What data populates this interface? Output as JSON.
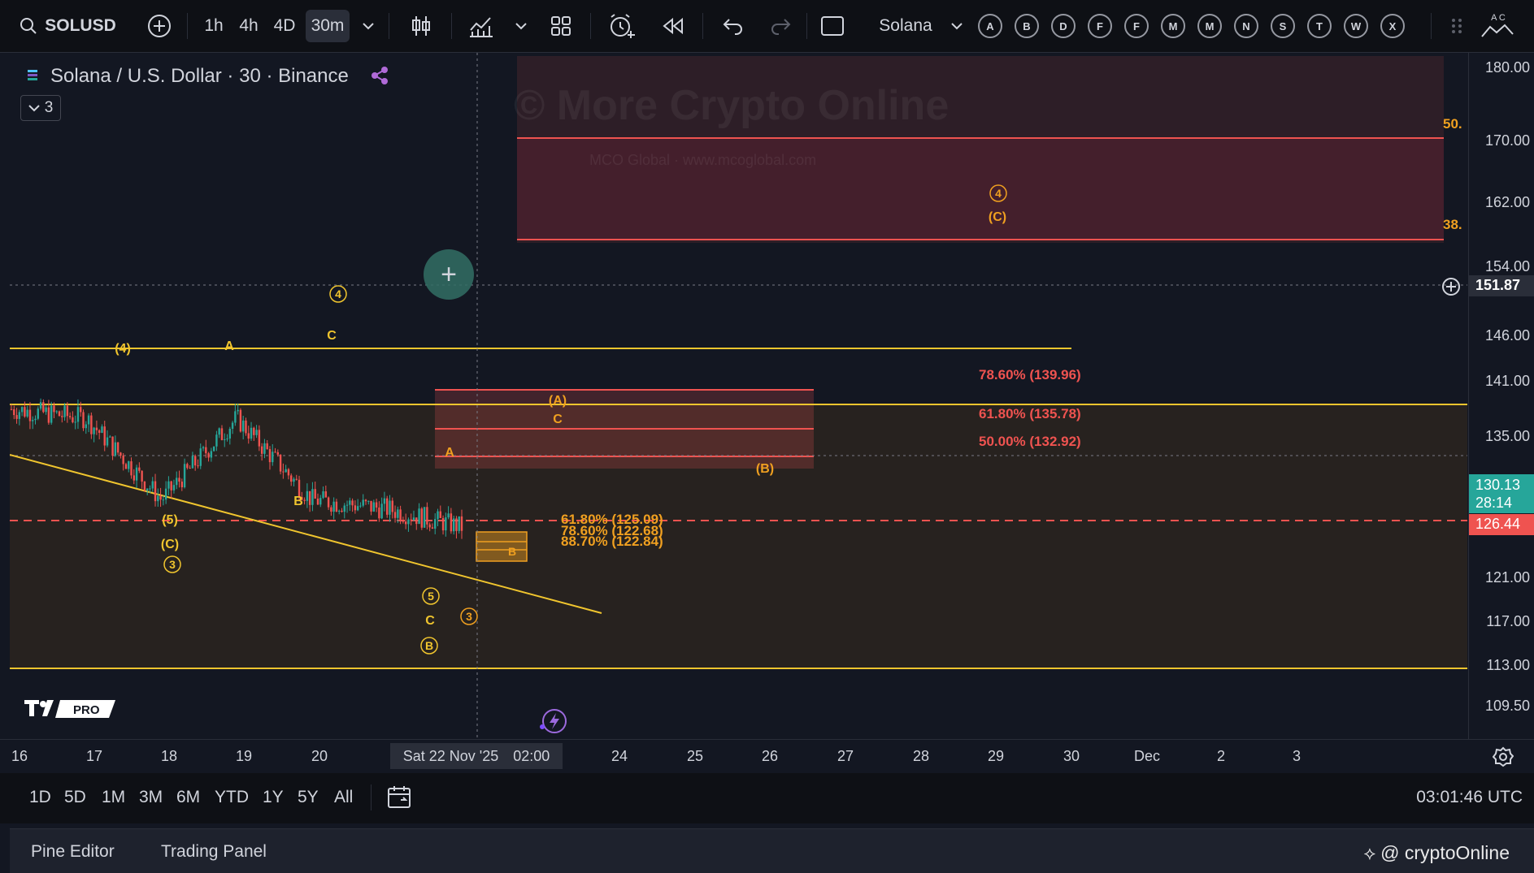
{
  "toolbar": {
    "symbol": "SOLUSD",
    "intervals": [
      "1h",
      "4h",
      "4D",
      "30m"
    ],
    "selected_interval": "30m",
    "layout_name": "Solana",
    "alert_letters": [
      "A",
      "B",
      "D",
      "F",
      "F",
      "M",
      "M",
      "N",
      "S",
      "T",
      "W",
      "X"
    ],
    "right_stub": "A C"
  },
  "legend": {
    "title": "Solana / U.S. Dollar · 30 · Binance",
    "collapse_count": "3"
  },
  "watermark": {
    "main": "© More Crypto Online",
    "sub": "MCO Global  ·  www.mcoglobal.com"
  },
  "price_axis": {
    "ticks": [
      "180.00",
      "170.00",
      "162.00",
      "154.00",
      "146.00",
      "141.00",
      "135.00",
      "121.00",
      "117.00",
      "113.00",
      "109.50"
    ],
    "crosshair_price": "151.87",
    "last_price": "130.13",
    "countdown": "28:14",
    "level_price": "126.44"
  },
  "fib_labels": {
    "upper_50": "50.",
    "upper_38": "38.",
    "r786": "78.60% (139.96)",
    "r618": "61.80% (135.78)",
    "r500": "50.00% (132.92)",
    "s618": "61.80% (125.09)",
    "s786": "78.60% (122.68)",
    "s887": "88.70% (122.84)"
  },
  "wave_labels": {
    "w4_top": "4",
    "w4_c_circle": "4",
    "w4_c_paren": "(C)",
    "p4": "(4)",
    "A1": "A",
    "C1": "C",
    "B1": "B",
    "p5": "(5)",
    "pC": "(C)",
    "c3": "3",
    "c5": "5",
    "C2": "C",
    "cB": "B",
    "c3b": "3",
    "pA": "(A)",
    "C3": "C",
    "A2": "A",
    "pB": "(B)",
    "B2": "B"
  },
  "time_axis": {
    "ticks": [
      "16",
      "17",
      "18",
      "19",
      "20",
      "24",
      "25",
      "26",
      "27",
      "28",
      "29",
      "30",
      "Dec",
      "2",
      "3"
    ],
    "crosshair_date": "Sat 22 Nov '25",
    "crosshair_time": "02:00"
  },
  "range_bar": {
    "ranges": [
      "1D",
      "5D",
      "1M",
      "3M",
      "6M",
      "YTD",
      "1Y",
      "5Y",
      "All"
    ],
    "clock": "03:01:46 UTC"
  },
  "bottom_bar": {
    "tabs": [
      "Pine Editor",
      "Trading Panel"
    ],
    "brand": "@ cryptoOnline"
  },
  "colors": {
    "background": "#131722",
    "up": "#26a69a",
    "down": "#ef5350",
    "fib_yellow": "#f0c52e",
    "wave_orange": "#f0a020",
    "red_zone": "#ef5350"
  },
  "chart_data": {
    "type": "candlestick",
    "symbol": "SOLUSD",
    "interval": "30m",
    "exchange": "Binance",
    "x_range": [
      "16 Nov",
      "3 Dec"
    ],
    "ylim": [
      109.5,
      180
    ],
    "price_series": {
      "x": [
        "16",
        "17",
        "18",
        "19",
        "20",
        "21",
        "22"
      ],
      "close": [
        141,
        140,
        131,
        140,
        131,
        130,
        128
      ]
    },
    "lines": [
      {
        "name": "resistance",
        "price": 145.2
      },
      {
        "name": "upper support",
        "price": 138.5
      },
      {
        "name": "lower support",
        "price": 117.3
      },
      {
        "name": "current",
        "price": 126.44
      },
      {
        "name": "crosshair",
        "price": 151.87
      }
    ]
  }
}
